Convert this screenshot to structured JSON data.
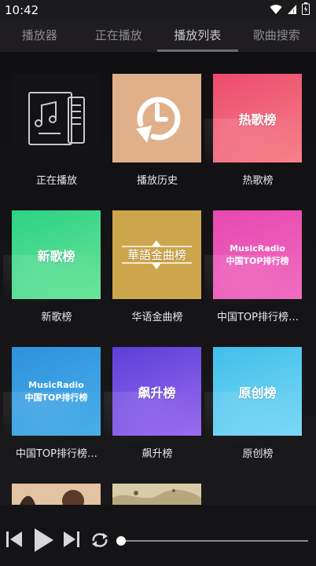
{
  "status": {
    "time": "10:42"
  },
  "tabs": [
    {
      "label": "播放器"
    },
    {
      "label": "正在播放"
    },
    {
      "label": "播放列表"
    },
    {
      "label": "歌曲搜索"
    }
  ],
  "tiles": [
    {
      "label": "正在播放"
    },
    {
      "label": "播放历史"
    },
    {
      "label": "热歌榜",
      "cover_text": "热歌榜"
    },
    {
      "label": "新歌榜",
      "cover_text": "新歌榜"
    },
    {
      "label": "华语金曲榜",
      "cover_text": "華語金曲榜"
    },
    {
      "label": "中国TOP排行榜…",
      "cover_brand": "MusicRadio",
      "cover_text": "中国TOP排行榜"
    },
    {
      "label": "中国TOP排行榜…",
      "cover_brand": "MusicRadio",
      "cover_text": "中国TOP排行榜"
    },
    {
      "label": "飙升榜",
      "cover_text": "飙升榜"
    },
    {
      "label": "原创榜",
      "cover_text": "原创榜"
    }
  ],
  "progress": {
    "value": 0.0
  },
  "colors": {
    "hot": "#f16a7c",
    "new": "#3fd88a",
    "gold": "#cda54c",
    "pink": "#ea55b3",
    "blue": "#3e9fe0",
    "purple": "#7c56e6",
    "cyan": "#55c9ef",
    "history": "#e0b08a"
  }
}
